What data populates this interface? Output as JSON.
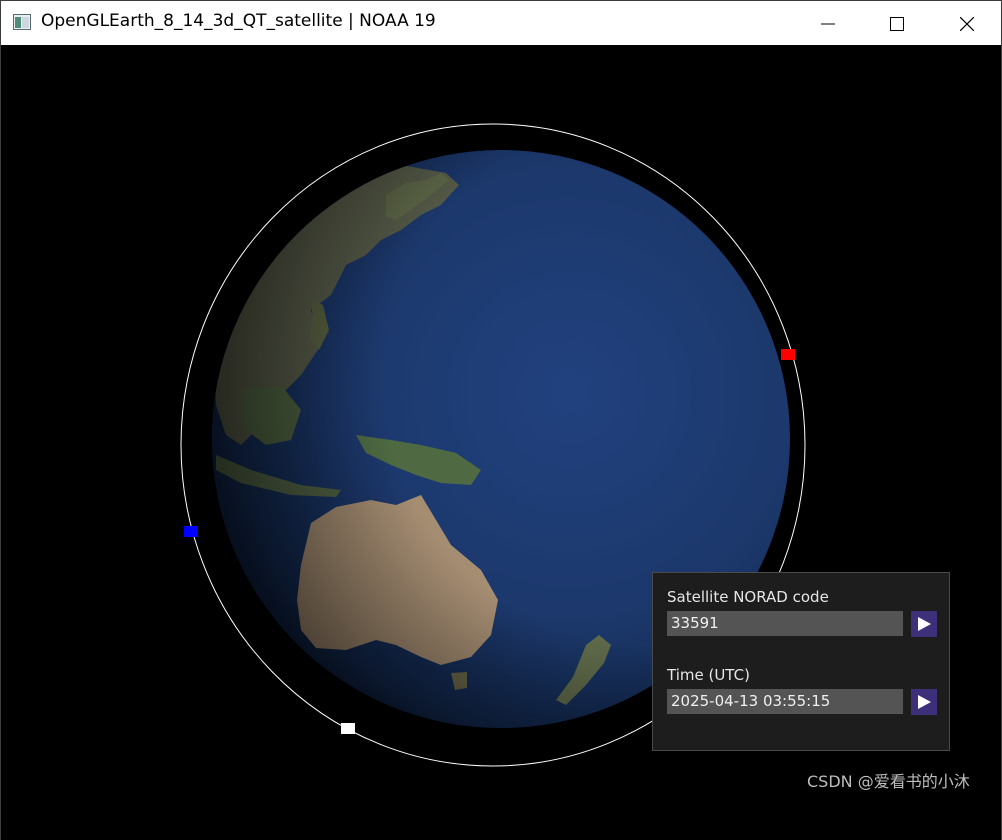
{
  "window": {
    "title": "OpenGLEarth_8_14_3d_QT_satellite | NOAA 19",
    "app_icon": "qt-window-icon",
    "controls": {
      "minimize_icon": "minimize-icon",
      "maximize_icon": "maximize-icon",
      "close_icon": "close-icon"
    }
  },
  "scene": {
    "background_color": "#000000",
    "globe": {
      "ocean_color": "#1e3a72",
      "land_color": "#6b6a48",
      "desert_color": "#b89a7a"
    },
    "orbit_color": "#ffffff",
    "markers": [
      {
        "name": "red-satellite-marker",
        "color": "#ff0000"
      },
      {
        "name": "blue-satellite-marker",
        "color": "#0000ff"
      },
      {
        "name": "white-satellite-marker",
        "color": "#ffffff"
      }
    ]
  },
  "panel": {
    "norad_label": "Satellite NORAD code",
    "norad_value": "33591",
    "time_label": "Time (UTC)",
    "time_value": "2025-04-13 03:55:15",
    "play_icon": "play-icon",
    "button_color": "#3e2f7a"
  },
  "watermark": "CSDN @爱看书的小沐"
}
